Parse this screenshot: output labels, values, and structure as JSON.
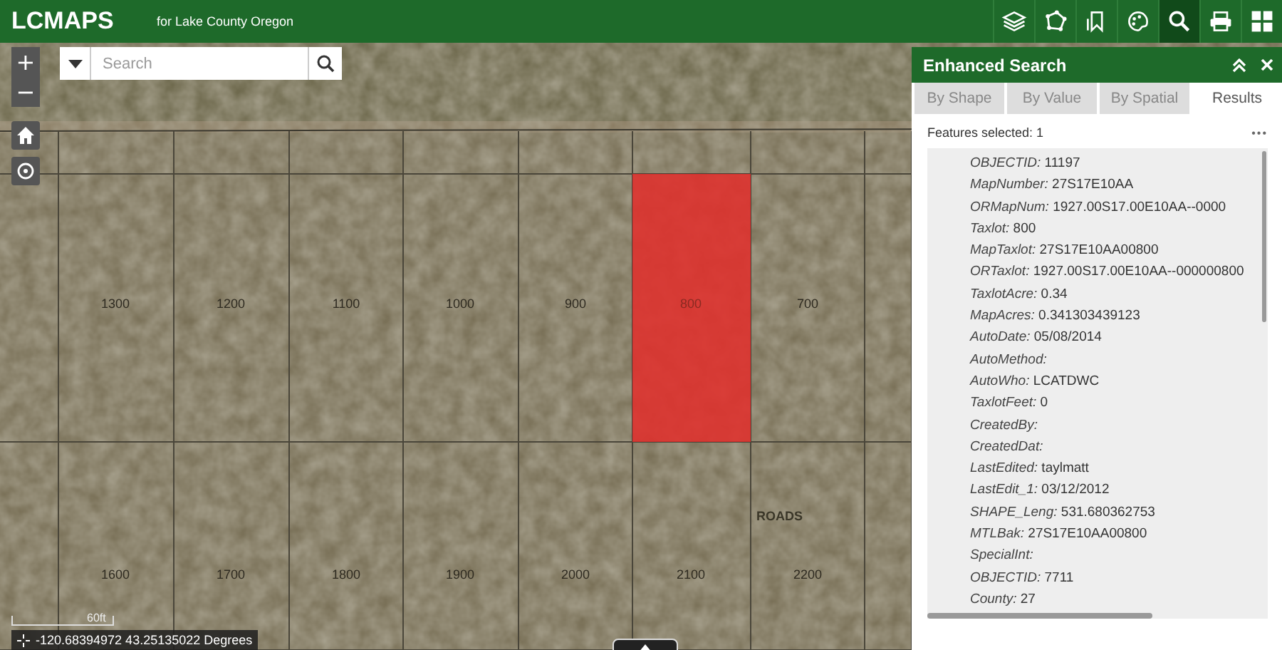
{
  "header": {
    "title": "LCMAPS",
    "subtitle": "for Lake County Oregon",
    "tools": [
      {
        "kind": "layers",
        "selected": false
      },
      {
        "kind": "polygon",
        "selected": false
      },
      {
        "kind": "bookmark",
        "selected": false
      },
      {
        "kind": "palette",
        "selected": false
      },
      {
        "kind": "search",
        "selected": true
      },
      {
        "kind": "print",
        "selected": false
      },
      {
        "kind": "grid",
        "selected": false
      }
    ]
  },
  "map": {
    "search": {
      "placeholder": "Search"
    },
    "zoom_buttons": [
      "+",
      "−"
    ],
    "parcel_rows": [
      {
        "parcels": [
          {
            "label": "1300",
            "selected": false
          },
          {
            "label": "1200",
            "selected": false
          },
          {
            "label": "1100",
            "selected": false
          },
          {
            "label": "1000",
            "selected": false
          },
          {
            "label": "900",
            "selected": false
          },
          {
            "label": "800",
            "selected": true
          },
          {
            "label": "700",
            "selected": false
          }
        ]
      },
      {
        "parcels": [
          {
            "label": "1600",
            "selected": false
          },
          {
            "label": "1700",
            "selected": false
          },
          {
            "label": "1800",
            "selected": false
          },
          {
            "label": "1900",
            "selected": false
          },
          {
            "label": "2000",
            "selected": false
          },
          {
            "label": "2100",
            "selected": false
          },
          {
            "label": "2200",
            "selected": false
          }
        ]
      }
    ],
    "road_label": "ROADS",
    "scale_label": "60ft",
    "coordinates": "-120.68394972 43.25135022 Degrees"
  },
  "panel": {
    "title": "Enhanced Search",
    "tabs": [
      {
        "label": "By Shape",
        "selected": false
      },
      {
        "label": "By Value",
        "selected": false
      },
      {
        "label": "By Spatial",
        "selected": false
      },
      {
        "label": "Results",
        "selected": true
      }
    ],
    "features_selected": "Features selected: 1",
    "menu": "•••",
    "attributes": [
      {
        "label": "OBJECTID:",
        "value": "11197"
      },
      {
        "label": "MapNumber:",
        "value": "27S17E10AA"
      },
      {
        "label": "ORMapNum:",
        "value": "1927.00S17.00E10AA--0000"
      },
      {
        "label": "Taxlot:",
        "value": "800"
      },
      {
        "label": "MapTaxlot:",
        "value": "27S17E10AA00800"
      },
      {
        "label": "ORTaxlot:",
        "value": "1927.00S17.00E10AA--000000800"
      },
      {
        "label": "TaxlotAcre:",
        "value": "0.34"
      },
      {
        "label": "MapAcres:",
        "value": "0.341303439123"
      },
      {
        "label": "AutoDate:",
        "value": "05/08/2014"
      },
      {
        "label": "AutoMethod:"
      },
      {
        "label": "AutoWho:",
        "value": "LCATDWC"
      },
      {
        "label": "TaxlotFeet:",
        "value": "0"
      },
      {
        "label": "CreatedBy:"
      },
      {
        "label": "CreatedDat:"
      },
      {
        "label": "LastEdited:",
        "value": "taylmatt"
      },
      {
        "label": "LastEdit_1:",
        "value": "03/12/2012"
      },
      {
        "label": "SHAPE_Leng:",
        "value": "531.680362753"
      },
      {
        "label": "MTLBak:",
        "value": "27S17E10AA00800"
      },
      {
        "label": "SpecialInt:"
      },
      {
        "label": "OBJECTID:",
        "value": "7711"
      },
      {
        "label": "County:",
        "value": "27"
      }
    ]
  }
}
